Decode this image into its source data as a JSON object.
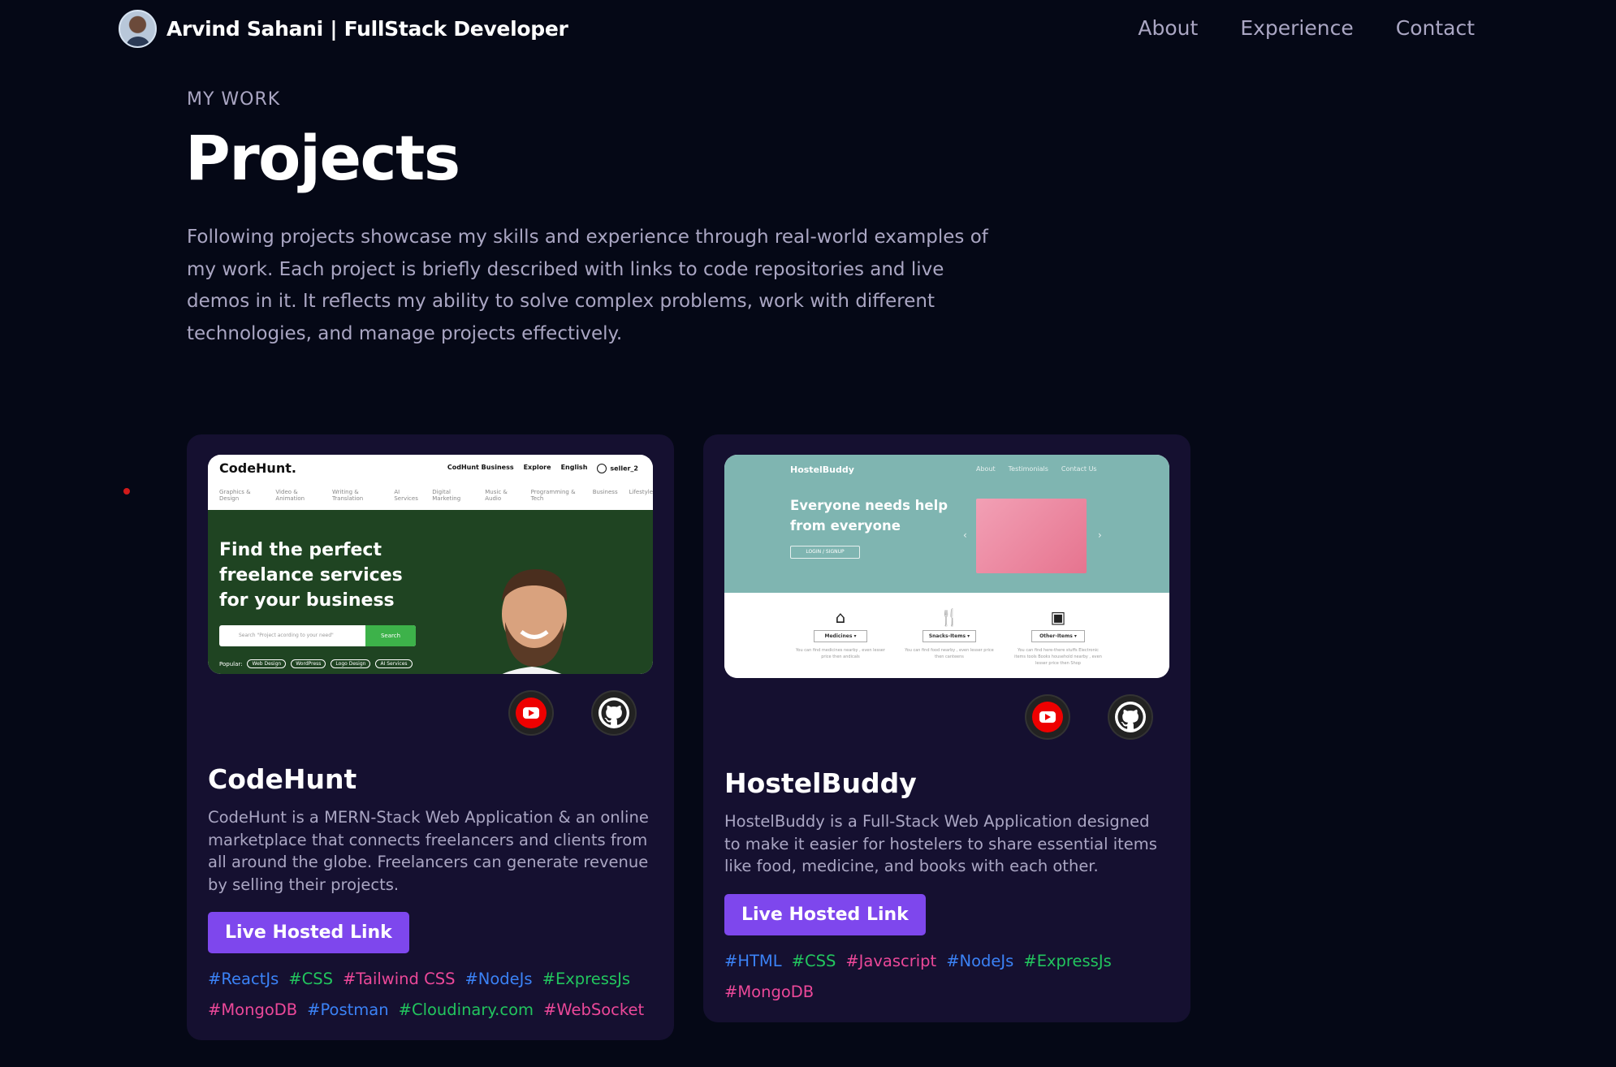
{
  "nav": {
    "brand": "Arvind Sahani | FullStack Developer",
    "links": [
      "About",
      "Experience",
      "Contact"
    ]
  },
  "header": {
    "subtitle": "MY WORK",
    "title": "Projects",
    "intro": "Following projects showcase my skills and experience through real-world examples of my work. Each project is briefly described with links to code repositories and live demos in it. It reflects my ability to solve complex problems, work with different technologies, and manage projects effectively."
  },
  "projects": [
    {
      "title": "CodeHunt",
      "description": "CodeHunt is a MERN-Stack Web Application & an online marketplace that connects freelancers and clients from all around the globe. Freelancers can generate revenue by selling their projects.",
      "button": "Live Hosted Link",
      "tags": [
        {
          "label": "#ReactJs",
          "color": "blue"
        },
        {
          "label": "#CSS",
          "color": "green"
        },
        {
          "label": "#Tailwind CSS",
          "color": "pink"
        },
        {
          "label": "#NodeJs",
          "color": "blue"
        },
        {
          "label": "#ExpressJs",
          "color": "green"
        },
        {
          "label": "#MongoDB",
          "color": "pink"
        },
        {
          "label": "#Postman",
          "color": "blue"
        },
        {
          "label": "#Cloudinary.com",
          "color": "green"
        },
        {
          "label": "#WebSocket",
          "color": "pink"
        }
      ],
      "preview": {
        "logo": "CodeHunt.",
        "links": [
          "CodHunt Business",
          "Explore",
          "English",
          "seller_2"
        ],
        "categories": [
          "Graphics & Design",
          "Video & Animation",
          "Writing & Translation",
          "AI Services",
          "Digital Marketing",
          "Music & Audio",
          "Programming & Tech",
          "Business",
          "Lifestyle"
        ],
        "hero": "Find the perfect freelance services for your business",
        "search_placeholder": "Search \"Project acording to your need\"",
        "search_button": "Search",
        "popular_label": "Popular:",
        "popular": [
          "Web Design",
          "WordPress",
          "Logo Design",
          "AI Services"
        ]
      }
    },
    {
      "title": "HostelBuddy",
      "description": "HostelBuddy is a Full-Stack Web Application designed to make it easier for hostelers to share essential items like food, medicine, and books with each other.",
      "button": "Live Hosted Link",
      "tags": [
        {
          "label": "#HTML",
          "color": "blue"
        },
        {
          "label": "#CSS",
          "color": "green"
        },
        {
          "label": "#Javascript",
          "color": "pink"
        },
        {
          "label": "#NodeJs",
          "color": "blue"
        },
        {
          "label": "#ExpressJs",
          "color": "green"
        },
        {
          "label": "#MongoDB",
          "color": "pink"
        }
      ],
      "preview": {
        "logo": "HostelBuddy",
        "nav": [
          "About",
          "Testimonials",
          "Contact Us"
        ],
        "hero": "Everyone needs help from everyone",
        "login": "LOGIN / SIGNUP",
        "items": [
          {
            "label": "Medicines ▾",
            "desc": "You can find medicines nearby , even lesser price then andicals"
          },
          {
            "label": "Snacks-Items ▾",
            "desc": "You can find food nearby , even lesser price then canteens"
          },
          {
            "label": "Other-Items ▾",
            "desc": "You can find here-there stuffs Electronic items tools Books household nearby , even lesser price then Shop"
          }
        ]
      }
    }
  ],
  "colors": {
    "background": "#050816",
    "card": "#151030",
    "accent": "#7e47ed",
    "text_secondary": "#aaa6c3",
    "tag_blue": "#3b82f6",
    "tag_green": "#22c55e",
    "tag_pink": "#ec4899"
  },
  "icons": [
    "youtube-icon",
    "github-icon"
  ]
}
